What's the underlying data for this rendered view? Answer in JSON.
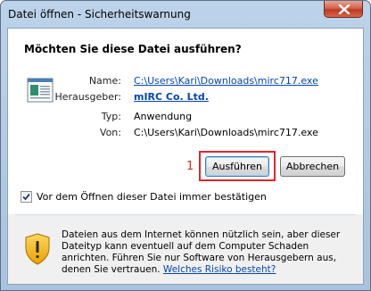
{
  "window": {
    "title": "Datei öffnen - Sicherheitswarnung"
  },
  "header": {
    "question": "Möchten Sie diese Datei ausführen?"
  },
  "file_info": {
    "name_label": "Name:",
    "name_value": "C:\\Users\\Kari\\Downloads\\mirc717.exe",
    "publisher_label": "Herausgeber:",
    "publisher_value": "mIRC Co. Ltd.",
    "type_label": "Typ:",
    "type_value": "Anwendung",
    "from_label": "Von:",
    "from_value": "C:\\Users\\Kari\\Downloads\\mirc717.exe"
  },
  "annotation": {
    "number": "1",
    "color": "#e0262b"
  },
  "buttons": {
    "run": "Ausführen",
    "cancel": "Abbrechen"
  },
  "checkbox": {
    "label": "Vor dem Öffnen dieser Datei immer bestätigen",
    "checked": true
  },
  "warning": {
    "text": "Dateien aus dem Internet können nützlich sein, aber dieser Dateityp kann eventuell auf dem Computer Schaden anrichten. Führen Sie nur Software von Herausgebern aus, denen Sie vertrauen. ",
    "link": "Welches Risiko besteht?"
  },
  "icons": {
    "close": "close-icon",
    "file": "application-file-icon",
    "shield": "security-shield-icon",
    "check": "checkmark-icon"
  },
  "colors": {
    "link": "#0645ad",
    "titlebar": "#bcd3ea",
    "close_button": "#c0391d"
  }
}
